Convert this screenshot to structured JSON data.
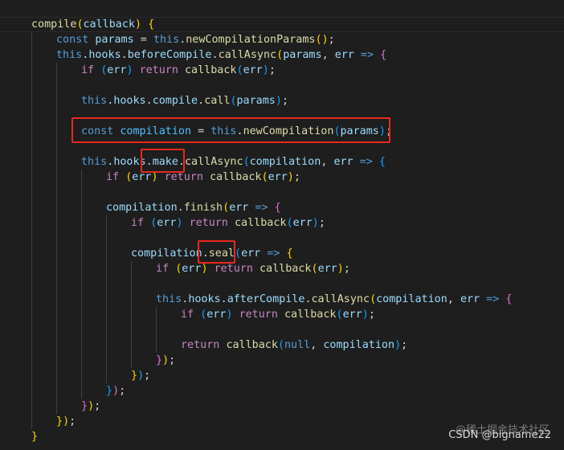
{
  "editor": {
    "lines": [
      [
        "compile",
        "(",
        "callback",
        ") ",
        "{"
      ],
      [
        "const ",
        "params",
        " = ",
        "this",
        ".",
        "newCompilationParams",
        "(",
        ")",
        ";"
      ],
      [
        "this",
        ".",
        "hooks",
        ".",
        "beforeCompile",
        ".",
        "callAsync",
        "(",
        "params",
        ", ",
        "err",
        " => ",
        "{"
      ],
      [
        "if ",
        "(",
        "err",
        ") ",
        "return ",
        "callback",
        "(",
        "err",
        ")",
        ";"
      ],
      [
        "this",
        ".",
        "hooks",
        ".",
        "compile",
        ".",
        "call",
        "(",
        "params",
        ")",
        ";"
      ],
      [
        "const ",
        "compilation",
        " = ",
        "this",
        ".",
        "newCompilation",
        "(",
        "params",
        ")",
        ";"
      ],
      [
        "this",
        ".",
        "hooks",
        ".",
        "make",
        ".",
        "callAsync",
        "(",
        "compilation",
        ", ",
        "err",
        " => ",
        "{"
      ],
      [
        "if ",
        "(",
        "err",
        ") ",
        "return ",
        "callback",
        "(",
        "err",
        ")",
        ";"
      ],
      [
        "compilation",
        ".",
        "finish",
        "(",
        "err",
        " => ",
        "{"
      ],
      [
        "if ",
        "(",
        "err",
        ") ",
        "return ",
        "callback",
        "(",
        "err",
        ")",
        ";"
      ],
      [
        "compilation",
        ".",
        "seal",
        "(",
        "err",
        " => ",
        "{"
      ],
      [
        "if ",
        "(",
        "err",
        ") ",
        "return ",
        "callback",
        "(",
        "err",
        ")",
        ";"
      ],
      [
        "this",
        ".",
        "hooks",
        ".",
        "afterCompile",
        ".",
        "callAsync",
        "(",
        "compilation",
        ", ",
        "err",
        " => ",
        "{"
      ],
      [
        "if ",
        "(",
        "err",
        ") ",
        "return ",
        "callback",
        "(",
        "err",
        ")",
        ";"
      ],
      [
        "return ",
        "callback",
        "(",
        "null",
        ", ",
        "compilation",
        ")",
        ";"
      ],
      [
        "}",
        ")",
        ";"
      ],
      [
        "}",
        ")",
        ";"
      ],
      [
        "}",
        ")",
        ";"
      ],
      [
        "}",
        ")",
        ";"
      ],
      [
        "}",
        ")",
        ";"
      ],
      [
        "}"
      ]
    ]
  },
  "watermark": {
    "line1": "@稀土掘金技术社区",
    "line2": "CSDN @bigname22"
  },
  "colors": {
    "background": "#1e1e1e",
    "keyword": "#569cd6",
    "control": "#c586c0",
    "function": "#dcdcaa",
    "variable": "#9cdcfe",
    "highlight_box": "#e8281c"
  }
}
